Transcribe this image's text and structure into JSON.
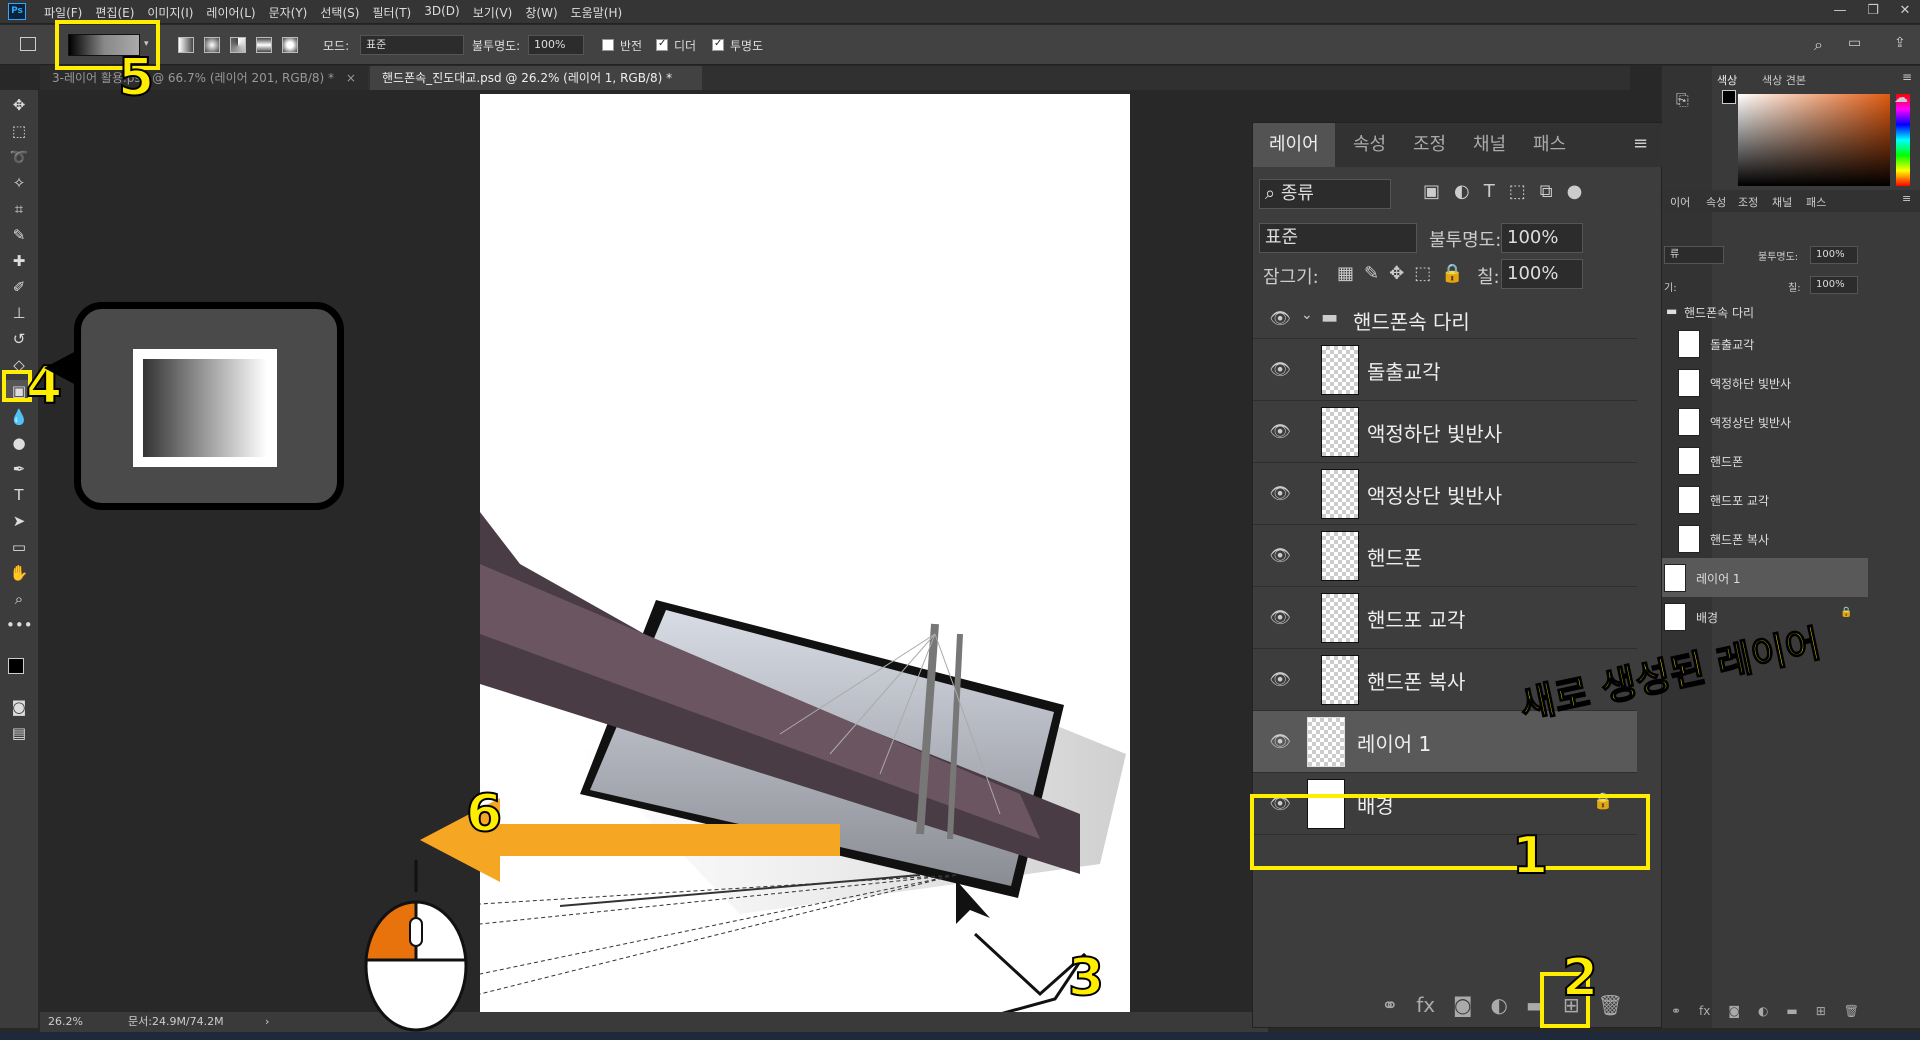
{
  "menubar": {
    "logo": "Ps",
    "items": [
      "파일(F)",
      "편집(E)",
      "이미지(I)",
      "레이어(L)",
      "문자(Y)",
      "선택(S)",
      "필터(T)",
      "3D(D)",
      "보기(V)",
      "창(W)",
      "도움말(H)"
    ]
  },
  "options": {
    "mode_label": "모드:",
    "mode_value": "표준",
    "opacity_label": "불투명도:",
    "opacity_value": "100%",
    "reverse": "반전",
    "dither": "디더",
    "transparency": "투명도"
  },
  "doctabs": [
    {
      "label": "3-레이어 활용.psd @ 66.7% (레이어 201, RGB/8) *",
      "close": "×"
    },
    {
      "label": "핸드폰속_진도대교.psd @ 26.2% (레이어 1, RGB/8) *",
      "close": "×"
    }
  ],
  "status": {
    "zoom": "26.2%",
    "doc": "문서:24.9M/74.2M"
  },
  "layers_panel": {
    "tabs": [
      "레이어",
      "속성",
      "조정",
      "채널",
      "패스"
    ],
    "filter": "종류",
    "blend": "표준",
    "opacity_label": "불투명도:",
    "opacity": "100%",
    "lock_label": "잠그기:",
    "fill_label": "칠:",
    "fill": "100%",
    "group": "핸드폰속 다리",
    "layers": [
      "돌출교각",
      "액정하단 빛반사",
      "액정상단 빛반사",
      "핸드폰",
      "핸드포 교각",
      "핸드폰 복사"
    ],
    "layer1": "레이어 1",
    "background": "배경"
  },
  "right_panel": {
    "color_tabs": [
      "색상",
      "색상 견본"
    ],
    "layer_tabs": [
      "이어",
      "속성",
      "조정",
      "채널",
      "패스"
    ],
    "filter": "류",
    "opacity_label": "불투명도:",
    "opacity": "100%",
    "fill_label": "칠:",
    "fill": "100%",
    "lock_label": "기:",
    "group": "핸드폰속 다리",
    "layers": [
      "돌출교각",
      "액정하단 빛반사",
      "액정상단 빛반사",
      "핸드폰",
      "핸드포 교각",
      "핸드폰 복사",
      "레이어 1",
      "배경"
    ]
  },
  "annotations": {
    "n1": "1",
    "n2": "2",
    "n3": "3",
    "n4": "4",
    "n5": "5",
    "n6": "6",
    "new_layer_text": "새로 생성된 레이어"
  },
  "colors": {
    "highlight": "#ffee00",
    "arrow": "#f5a623",
    "mouse_button": "#e8720c"
  }
}
